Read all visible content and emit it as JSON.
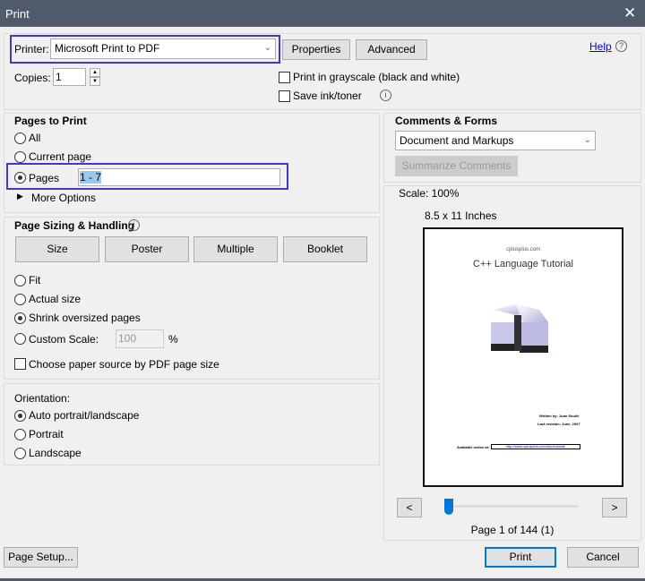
{
  "window": {
    "title": "Print",
    "close": "✕"
  },
  "printer": {
    "label": "Printer:",
    "value": "Microsoft Print to PDF",
    "properties": "Properties",
    "advanced": "Advanced",
    "help": "Help",
    "help_icon": "?"
  },
  "copies": {
    "label": "Copies:",
    "value": "1"
  },
  "options": {
    "grayscale": "Print in grayscale (black and white)",
    "grayscale_checked": false,
    "save_ink": "Save ink/toner",
    "save_ink_checked": false
  },
  "pages_to_print": {
    "title": "Pages to Print",
    "all": "All",
    "current": "Current page",
    "pages": "Pages",
    "pages_value": "1 - 7",
    "selected": "Pages",
    "more_options": "More Options"
  },
  "sizing": {
    "title": "Page Sizing & Handling",
    "buttons": [
      "Size",
      "Poster",
      "Multiple",
      "Booklet"
    ],
    "fit": "Fit",
    "actual": "Actual size",
    "shrink": "Shrink oversized pages",
    "custom": "Custom Scale:",
    "custom_value": "100",
    "percent": "%",
    "selected": "Shrink oversized pages",
    "paper_source": "Choose paper source by PDF page size",
    "paper_source_checked": false
  },
  "orientation": {
    "title": "Orientation:",
    "auto": "Auto portrait/landscape",
    "portrait": "Portrait",
    "landscape": "Landscape",
    "selected": "Auto portrait/landscape"
  },
  "comments": {
    "title": "Comments & Forms",
    "value": "Document and Markups",
    "summarize": "Summarize Comments"
  },
  "preview": {
    "scale": "Scale: 100%",
    "size": "8.5 x 11 Inches",
    "site": "cplusplus.com",
    "doc_title": "C++ Language Tutorial",
    "author": "Written by: Juan Soulié",
    "revision": "Last revision: June, 2007",
    "online": "Available online at:",
    "url": "http://www.cplusplus.com/doc/tutorial/",
    "prev": "<",
    "next": ">",
    "page_label": "Page 1 of 144 (1)",
    "current_page": 1,
    "total_pages": 144
  },
  "footer": {
    "page_setup": "Page Setup...",
    "print": "Print",
    "cancel": "Cancel"
  },
  "colors": {
    "titlebar": "#4f5b6b",
    "highlight": "#3b3bc8",
    "slider": "#0078d7",
    "link": "#0000ee"
  }
}
